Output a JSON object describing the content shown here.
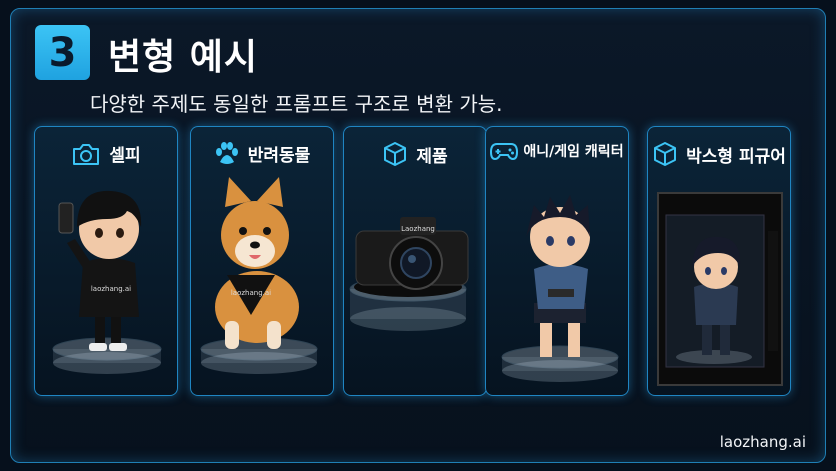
{
  "header": {
    "step_number": "3",
    "title": "변형 예시",
    "subtitle": "다양한 주제도 동일한 프롬프트 구조로 변환 가능."
  },
  "cards": [
    {
      "label": "셀피",
      "icon": "camera-icon",
      "figure_text": "laozhang.ai"
    },
    {
      "label": "반려동물",
      "icon": "paw-icon",
      "figure_text": "laozhang.ai"
    },
    {
      "label": "제품",
      "icon": "box-icon",
      "figure_text": "Laozhang"
    },
    {
      "label": "애니/게임 캐릭터",
      "icon": "gamepad-icon"
    },
    {
      "label": "박스형 피규어",
      "icon": "box-icon"
    }
  ],
  "watermark": "laozhang.ai",
  "colors": {
    "accent": "#3cc4f5",
    "border": "#1f85c2",
    "background": "#06101c"
  }
}
